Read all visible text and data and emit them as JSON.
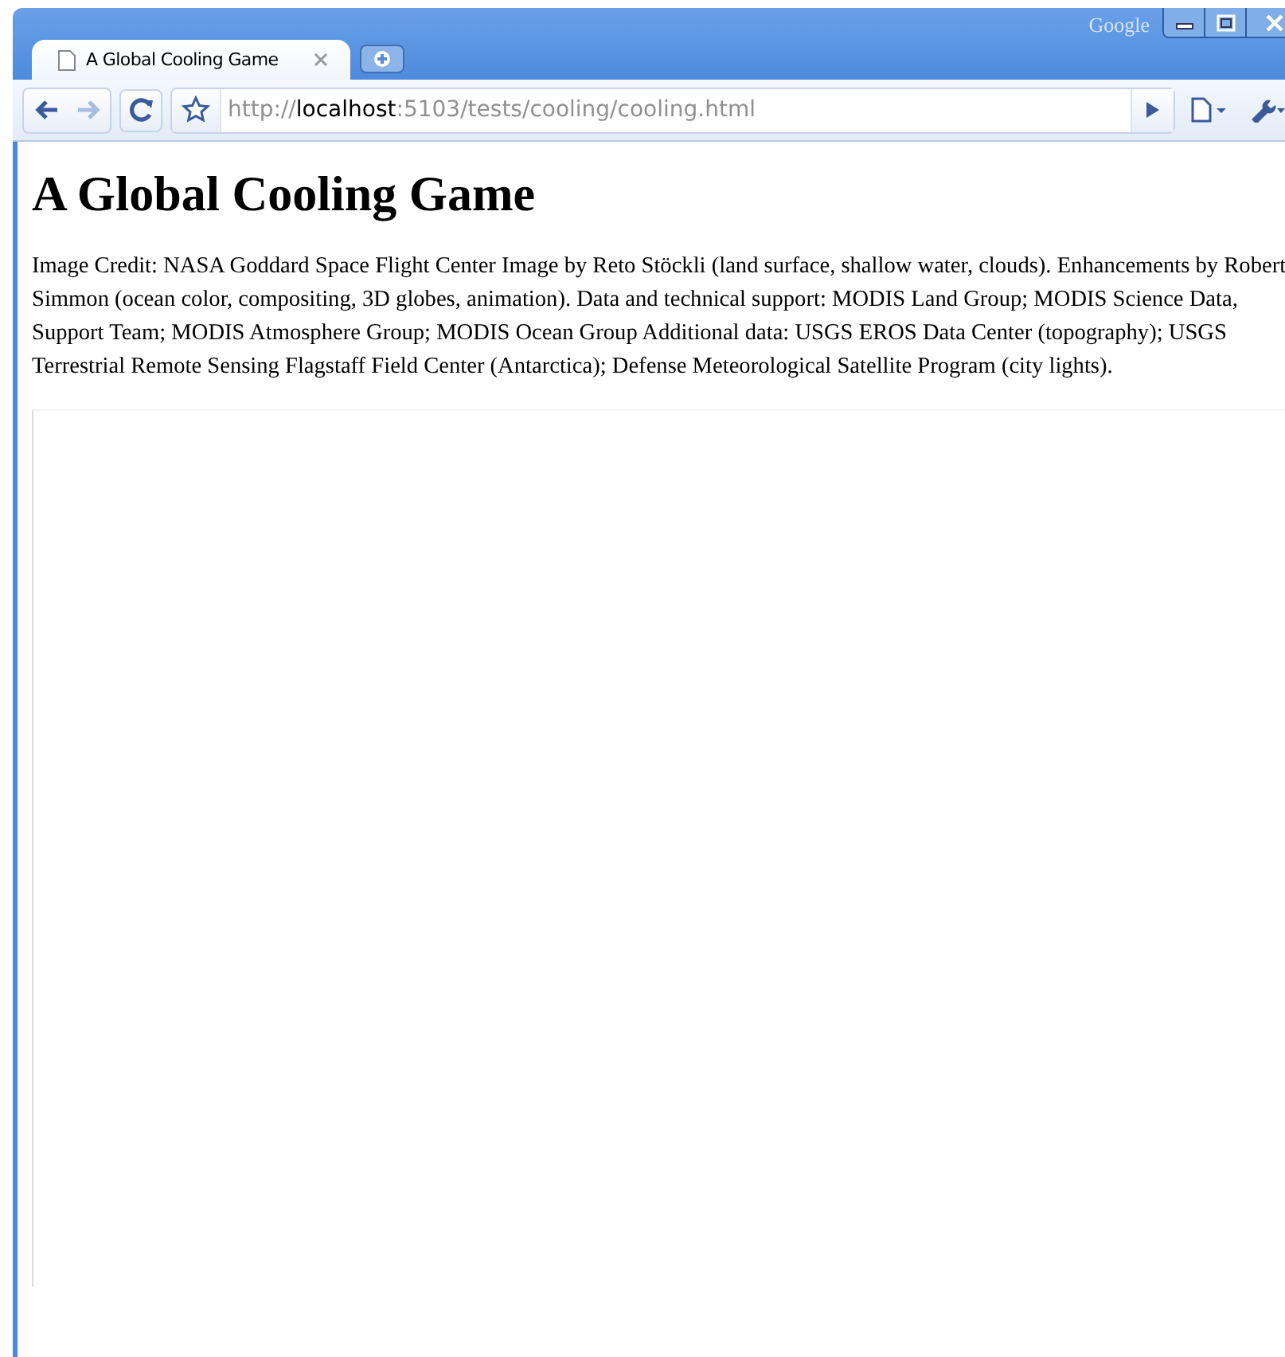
{
  "window": {
    "brand": "Google"
  },
  "tabs": [
    {
      "title": "A Global Cooling Game",
      "selected": true
    }
  ],
  "address_bar": {
    "scheme": "http://",
    "host": "localhost",
    "rest": ":5103/tests/cooling/cooling.html"
  },
  "toolbar": {
    "back_enabled": true,
    "forward_enabled": false
  },
  "page": {
    "heading": "A Global Cooling Game",
    "credit": "Image Credit: NASA Goddard Space Flight Center Image by Reto Stöckli (land surface, shallow water, clouds). Enhancements by Robert Simmon (ocean color, compositing, 3D globes, animation). Data and technical support: MODIS Land Group; MODIS Science Data, Support Team; MODIS Atmosphere Group; MODIS Ocean Group Additional data: USGS EROS Data Center (topography); USGS Terrestrial Remote Sensing Flagstaff Field Center (Antarctica); Defense Meteorological Satellite Program (city lights)."
  }
}
